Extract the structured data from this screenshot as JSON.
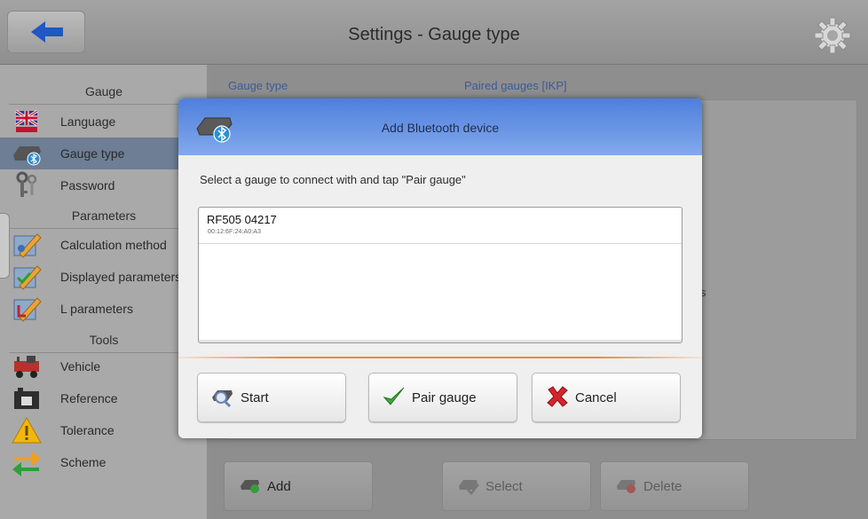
{
  "header": {
    "title": "Settings - Gauge type",
    "back_icon": "back-arrow-icon",
    "settings_icon": "gear-icon"
  },
  "sidebar": {
    "sections": [
      "Gauge",
      "Parameters",
      "Tools"
    ],
    "items": [
      {
        "label": "Language",
        "icon": "flag-icon"
      },
      {
        "label": "Gauge type",
        "icon": "bluetooth-gauge-icon",
        "selected": true
      },
      {
        "label": "Password",
        "icon": "keys-icon"
      },
      {
        "label": "Calculation method",
        "icon": "pencil-check-icon"
      },
      {
        "label": "Displayed parameters",
        "icon": "pencil-check-icon"
      },
      {
        "label": "L parameters",
        "icon": "pencil-check-icon"
      },
      {
        "label": "Vehicle",
        "icon": "vehicle-icon"
      },
      {
        "label": "Reference",
        "icon": "reference-icon"
      },
      {
        "label": "Tolerance",
        "icon": "warning-icon"
      },
      {
        "label": "Scheme",
        "icon": "swap-arrows-icon"
      }
    ]
  },
  "content": {
    "col_gauge_type": "Gauge type",
    "col_paired": "Paired gauges [IKP]",
    "partial_text": "s",
    "buttons": {
      "add": "Add",
      "select": "Select",
      "delete": "Delete"
    }
  },
  "dialog": {
    "title": "Add Bluetooth device",
    "instruction": "Select a gauge to connect with and tap \"Pair gauge\"",
    "devices": [
      {
        "name": "RF505 04217",
        "address": "00:12:6F:24:A0:A3"
      }
    ],
    "buttons": {
      "start": "Start",
      "pair": "Pair gauge",
      "cancel": "Cancel"
    }
  },
  "colors": {
    "dialog_header": "#5b8be0",
    "selected_item": "#6d7e95",
    "accent_divider": "#f08a2e",
    "back_arrow": "#1f57c4"
  }
}
